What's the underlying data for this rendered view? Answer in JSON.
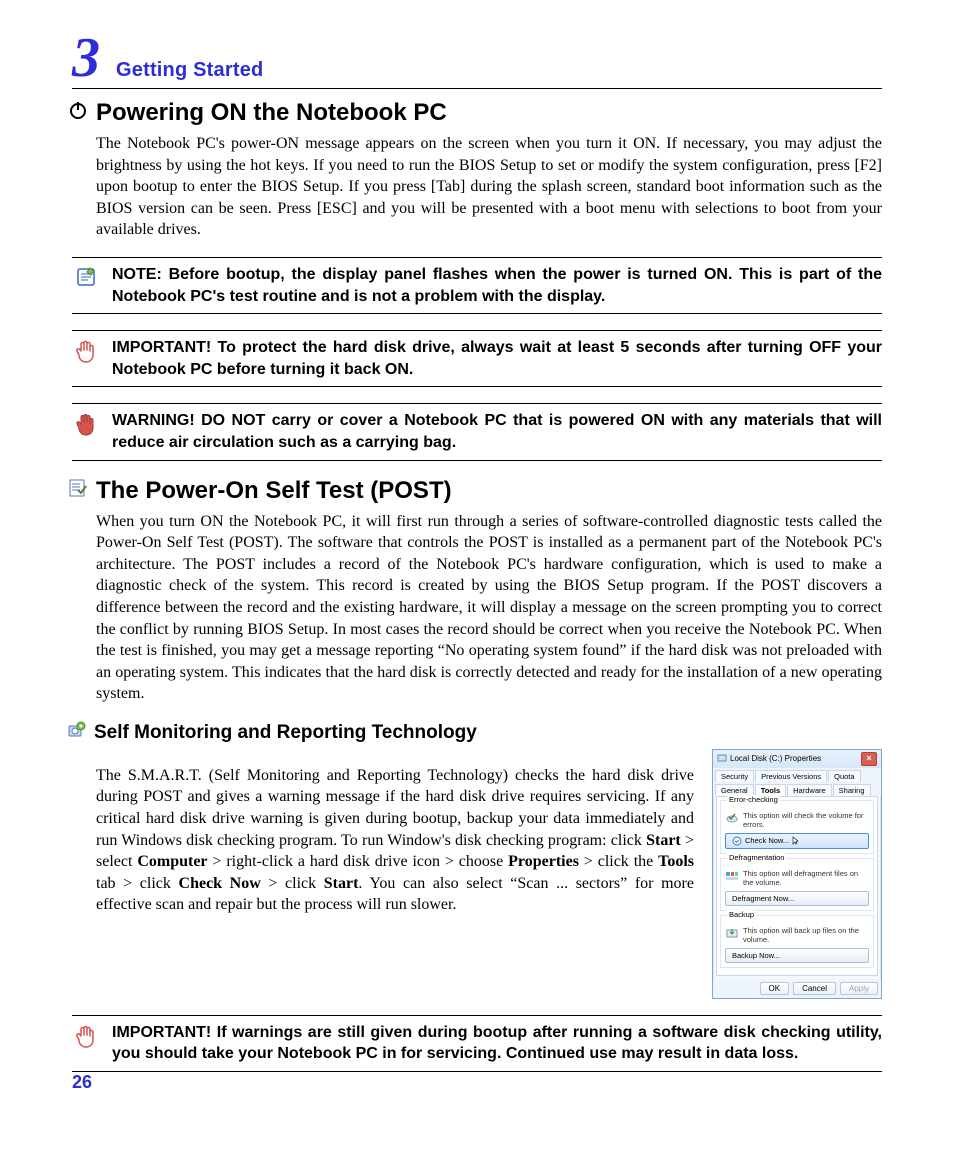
{
  "chapter": {
    "number": "3",
    "title": "Getting Started"
  },
  "section1": {
    "heading": "Powering ON the Notebook PC",
    "body": "The Notebook PC's power-ON message appears on the screen when you turn it ON. If necessary, you may adjust the brightness by using the hot keys. If you need to run the BIOS Setup to set or modify the system configuration, press [F2] upon bootup to enter the BIOS Setup. If you press [Tab] during the splash screen, standard boot information such as the BIOS version can be seen. Press [ESC] and you will be presented with a boot menu with selections to boot from your available drives."
  },
  "note": {
    "label": "NOTE:",
    "text": "  Before bootup, the display panel flashes when the power is turned ON. This is part of the Notebook PC's test routine and is not a problem with the display."
  },
  "important1": {
    "label": "IMPORTANT!",
    "text": "  To protect the hard disk drive, always wait at least 5 seconds after turning OFF your Notebook PC before turning it back ON."
  },
  "warning": {
    "label": "WARNING!",
    "text": " DO NOT carry or cover a Notebook PC that is powered ON with any materials that will reduce air circulation such as a carrying bag."
  },
  "section2": {
    "heading": "The Power-On Self Test (POST)",
    "body": "When you turn ON the Notebook PC, it will first run through a series of software-controlled diagnostic tests called the Power-On Self Test (POST). The software that controls the POST is installed as a permanent part of the Notebook PC's architecture. The POST includes a record of the Notebook PC's hardware configuration, which is used to make a diagnostic check of the system. This record is created by using the BIOS Setup program. If the POST discovers a difference between the record and the existing hardware, it will display a message on the screen prompting you to correct the conflict by running BIOS Setup. In most cases the record should be correct when you receive the Notebook PC. When the test is finished, you may get a message reporting “No operating system found” if the hard disk was not preloaded with an operating system. This indicates that the hard disk is correctly detected and ready for the installation of a new operating system."
  },
  "section3": {
    "heading": "Self Monitoring and Reporting Technology",
    "body_parts": [
      "The S.M.A.R.T. (Self Monitoring and Reporting Technology) checks the hard disk drive during POST and gives a warning message if the hard disk drive requires servicing. If any critical hard disk drive warning is given during bootup, backup your data immediately and run Windows disk checking program. To run Window's disk checking program: click ",
      "Start",
      " > select ",
      "Computer",
      " > right-click a hard disk drive icon > choose ",
      "Properties",
      " > click the ",
      "Tools",
      " tab > click ",
      "Check Now",
      " > click ",
      "Start",
      ". You can also select “Scan ... sectors” for more effective scan and repair but the process will run slower."
    ]
  },
  "dialog": {
    "title": "Local Disk (C:) Properties",
    "tabs_row1": [
      "Security",
      "Previous Versions",
      "Quota"
    ],
    "tabs_row2": [
      "General",
      "Tools",
      "Hardware",
      "Sharing"
    ],
    "active_tab": "Tools",
    "groups": {
      "error": {
        "title": "Error-checking",
        "text": "This option will check the volume for errors.",
        "button": "Check Now..."
      },
      "defrag": {
        "title": "Defragmentation",
        "text": "This option will defragment files on the volume.",
        "button": "Defragment Now..."
      },
      "backup": {
        "title": "Backup",
        "text": "This option will back up files on the volume.",
        "button": "Backup Now..."
      }
    },
    "buttons": {
      "ok": "OK",
      "cancel": "Cancel",
      "apply": "Apply"
    }
  },
  "important2": {
    "label": "IMPORTANT!",
    "text": " If warnings are still given during bootup after running a software disk checking utility, you should take your Notebook PC in for servicing. Continued use may result in data loss."
  },
  "page_number": "26"
}
